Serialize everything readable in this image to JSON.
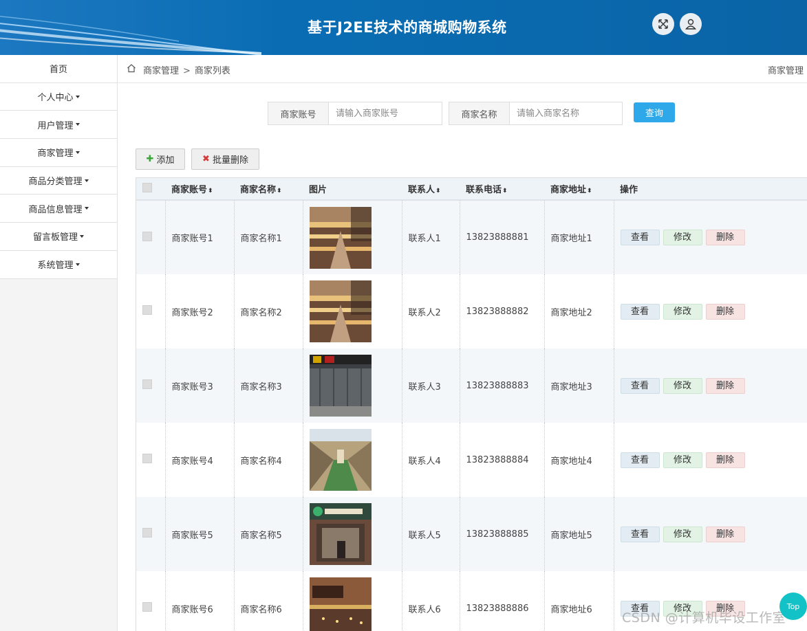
{
  "header": {
    "title": "基于J2EE技术的商城购物系统"
  },
  "sidebar": {
    "items": [
      {
        "label": "首页",
        "has_caret": false
      },
      {
        "label": "个人中心",
        "has_caret": true
      },
      {
        "label": "用户管理",
        "has_caret": true
      },
      {
        "label": "商家管理",
        "has_caret": true
      },
      {
        "label": "商品分类管理",
        "has_caret": true
      },
      {
        "label": "商品信息管理",
        "has_caret": true
      },
      {
        "label": "留言板管理",
        "has_caret": true
      },
      {
        "label": "系统管理",
        "has_caret": true
      }
    ]
  },
  "breadcrumb": {
    "level1": "商家管理",
    "separator": ">",
    "level2": "商家列表",
    "right": "商家管理"
  },
  "search": {
    "account_label": "商家账号",
    "account_placeholder": "请输入商家账号",
    "account_value": "",
    "name_label": "商家名称",
    "name_placeholder": "请输入商家名称",
    "name_value": "",
    "query_label": "查询"
  },
  "toolbar": {
    "add_label": "添加",
    "batch_delete_label": "批量删除"
  },
  "table": {
    "headers": [
      "商家账号",
      "商家名称",
      "图片",
      "联系人",
      "联系电话",
      "商家地址",
      "操作"
    ],
    "sortable": [
      true,
      true,
      false,
      true,
      true,
      true,
      false
    ],
    "actions": {
      "view": "查看",
      "edit": "修改",
      "delete": "删除"
    },
    "rows": [
      {
        "account": "商家账号1",
        "name": "商家名称1",
        "contact": "联系人1",
        "phone": "13823888881",
        "address": "商家地址1",
        "image": "mall-atrium"
      },
      {
        "account": "商家账号2",
        "name": "商家名称2",
        "contact": "联系人2",
        "phone": "13823888882",
        "address": "商家地址2",
        "image": "mall-atrium"
      },
      {
        "account": "商家账号3",
        "name": "商家名称3",
        "contact": "联系人3",
        "phone": "13823888883",
        "address": "商家地址3",
        "image": "glass-storefront"
      },
      {
        "account": "商家账号4",
        "name": "商家名称4",
        "contact": "联系人4",
        "phone": "13823888884",
        "address": "商家地址4",
        "image": "mall-interior"
      },
      {
        "account": "商家账号5",
        "name": "商家名称5",
        "contact": "联系人5",
        "phone": "13823888885",
        "address": "商家地址5",
        "image": "shop-front"
      },
      {
        "account": "商家账号6",
        "name": "商家名称6",
        "contact": "联系人6",
        "phone": "13823888886",
        "address": "商家地址6",
        "image": "cafe-front"
      }
    ]
  },
  "watermark": "CSDN @计算机毕设工作室",
  "top_button": "Top"
}
